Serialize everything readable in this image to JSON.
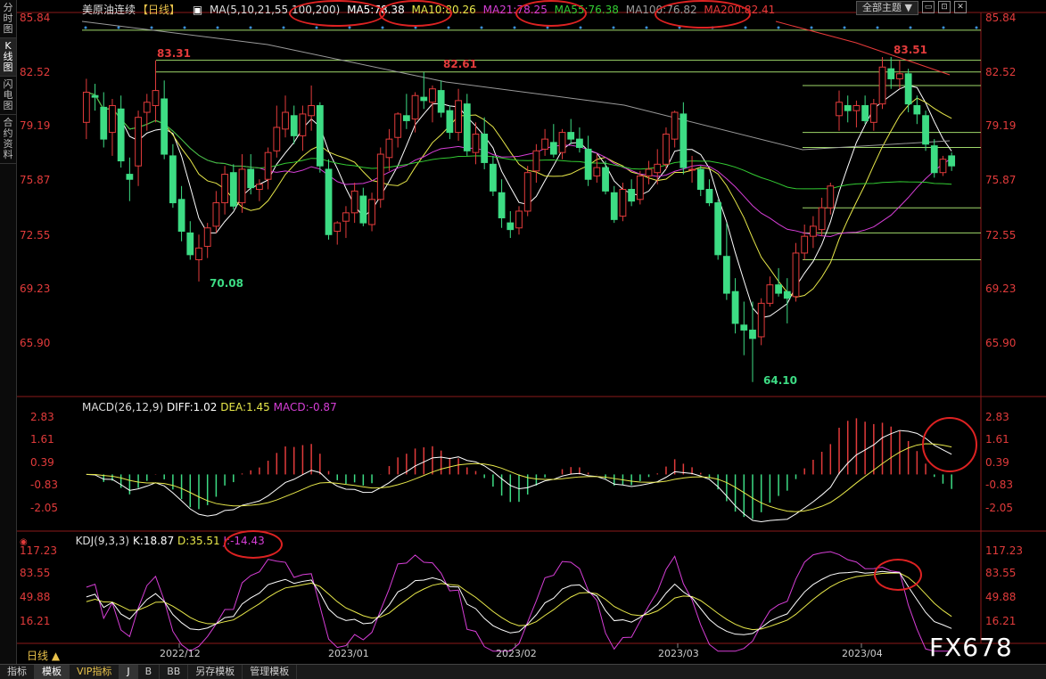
{
  "sidebar": {
    "tabs": [
      {
        "label": "分时图"
      },
      {
        "label": "K线图"
      },
      {
        "label": "闪电图"
      },
      {
        "label": "合约资料"
      }
    ]
  },
  "header": {
    "instrument": "美原油连续",
    "period_tag": "【日线】",
    "ma_params": "MA(5,10,21,55,100,200)",
    "ma5": "MA5:78.38",
    "ma10": "MA10:80.26",
    "ma21": "MA21:78.25",
    "ma55": "MA55:76.38",
    "ma100": "MA100:76.82",
    "ma200": "MA200:82.41",
    "theme_button": "全部主题",
    "theme_arrow": "▼"
  },
  "colors": {
    "up": "#e23b3b",
    "down": "#3ddc84",
    "ma5": "#ffffff",
    "ma10": "#e8e84a",
    "ma21": "#d63ed6",
    "ma55": "#33cc33",
    "ma100": "#9a9a9a",
    "ma200": "#e83a3a",
    "axis_text": "#e23b3b",
    "grid": "#8b1a1a"
  },
  "price_axis": {
    "ticks": [
      "85.84",
      "82.52",
      "79.19",
      "75.87",
      "72.55",
      "69.23",
      "65.90"
    ]
  },
  "annotations": {
    "high1": "83.31",
    "high2": "82.61",
    "high3": "83.51",
    "low1": "70.08",
    "low2": "64.10"
  },
  "macd": {
    "label": "MACD(26,12,9)",
    "diff": "DIFF:1.02",
    "dea": "DEA:1.45",
    "macd": "MACD:-0.87",
    "ticks": [
      "2.83",
      "1.61",
      "0.39",
      "-0.83",
      "-2.05"
    ]
  },
  "kdj": {
    "label": "KDJ(9,3,3)",
    "k": "K:18.87",
    "d": "D:35.51",
    "j": "J:-14.43",
    "ticks": [
      "117.23",
      "83.55",
      "49.88",
      "16.21"
    ]
  },
  "date_axis": {
    "labels": [
      "2022/12",
      "2023/01",
      "2023/02",
      "2023/03",
      "2023/04"
    ]
  },
  "period_label": "日线 ▲",
  "bottom_bar": {
    "items": [
      "指标",
      "模板",
      "VIP指标",
      "J",
      "B",
      "BB",
      "另存模板",
      "管理模板"
    ]
  },
  "watermark": "FX678",
  "chart_data": {
    "type": "candlestick",
    "title": "美原油连续 日线",
    "ylim": [
      63.5,
      85.84
    ],
    "candles": [
      {
        "o": 79.6,
        "h": 82.2,
        "l": 78.6,
        "c": 81.4
      },
      {
        "o": 81.2,
        "h": 81.9,
        "l": 80.3,
        "c": 81.1
      },
      {
        "o": 80.5,
        "h": 81.4,
        "l": 78.1,
        "c": 78.6
      },
      {
        "o": 79.0,
        "h": 81.0,
        "l": 77.6,
        "c": 80.6
      },
      {
        "o": 80.4,
        "h": 81.2,
        "l": 76.9,
        "c": 77.3
      },
      {
        "o": 76.5,
        "h": 77.5,
        "l": 74.9,
        "c": 76.2
      },
      {
        "o": 77.0,
        "h": 80.3,
        "l": 75.8,
        "c": 79.9
      },
      {
        "o": 80.2,
        "h": 81.3,
        "l": 79.1,
        "c": 80.8
      },
      {
        "o": 80.6,
        "h": 83.3,
        "l": 79.6,
        "c": 81.5
      },
      {
        "o": 81.0,
        "h": 82.1,
        "l": 77.4,
        "c": 77.7
      },
      {
        "o": 77.6,
        "h": 78.3,
        "l": 74.5,
        "c": 74.8
      },
      {
        "o": 75.0,
        "h": 75.8,
        "l": 72.5,
        "c": 73.1
      },
      {
        "o": 73.0,
        "h": 73.7,
        "l": 71.4,
        "c": 71.7
      },
      {
        "o": 71.4,
        "h": 72.9,
        "l": 70.1,
        "c": 72.1
      },
      {
        "o": 72.2,
        "h": 73.6,
        "l": 71.5,
        "c": 73.3
      },
      {
        "o": 73.4,
        "h": 75.5,
        "l": 73.0,
        "c": 74.8
      },
      {
        "o": 74.8,
        "h": 77.0,
        "l": 74.1,
        "c": 76.5
      },
      {
        "o": 76.6,
        "h": 77.1,
        "l": 74.4,
        "c": 74.6
      },
      {
        "o": 74.8,
        "h": 77.7,
        "l": 74.2,
        "c": 76.8
      },
      {
        "o": 76.8,
        "h": 77.7,
        "l": 75.3,
        "c": 75.7
      },
      {
        "o": 75.6,
        "h": 76.2,
        "l": 74.9,
        "c": 75.9
      },
      {
        "o": 76.2,
        "h": 78.1,
        "l": 75.6,
        "c": 77.8
      },
      {
        "o": 77.9,
        "h": 80.6,
        "l": 77.5,
        "c": 79.3
      },
      {
        "o": 79.2,
        "h": 81.2,
        "l": 78.7,
        "c": 80.2
      },
      {
        "o": 80.0,
        "h": 80.6,
        "l": 78.3,
        "c": 78.8
      },
      {
        "o": 78.8,
        "h": 80.6,
        "l": 77.9,
        "c": 80.1
      },
      {
        "o": 80.0,
        "h": 81.8,
        "l": 79.1,
        "c": 80.6
      },
      {
        "o": 80.6,
        "h": 80.8,
        "l": 76.6,
        "c": 77.0
      },
      {
        "o": 76.8,
        "h": 77.4,
        "l": 72.6,
        "c": 72.9
      },
      {
        "o": 73.1,
        "h": 73.7,
        "l": 72.3,
        "c": 73.6
      },
      {
        "o": 73.7,
        "h": 74.6,
        "l": 72.7,
        "c": 74.2
      },
      {
        "o": 74.2,
        "h": 76.0,
        "l": 73.6,
        "c": 75.5
      },
      {
        "o": 75.2,
        "h": 75.7,
        "l": 73.4,
        "c": 73.6
      },
      {
        "o": 73.5,
        "h": 75.4,
        "l": 73.1,
        "c": 75.0
      },
      {
        "o": 75.0,
        "h": 78.1,
        "l": 74.5,
        "c": 77.7
      },
      {
        "o": 77.5,
        "h": 79.2,
        "l": 76.7,
        "c": 78.6
      },
      {
        "o": 78.7,
        "h": 80.2,
        "l": 78.1,
        "c": 80.1
      },
      {
        "o": 80.0,
        "h": 81.3,
        "l": 79.2,
        "c": 79.7
      },
      {
        "o": 79.8,
        "h": 81.4,
        "l": 79.0,
        "c": 81.2
      },
      {
        "o": 81.1,
        "h": 82.6,
        "l": 80.4,
        "c": 80.9
      },
      {
        "o": 80.8,
        "h": 81.8,
        "l": 79.6,
        "c": 81.6
      },
      {
        "o": 81.5,
        "h": 82.1,
        "l": 79.9,
        "c": 80.2
      },
      {
        "o": 80.3,
        "h": 80.6,
        "l": 78.6,
        "c": 79.0
      },
      {
        "o": 79.0,
        "h": 81.6,
        "l": 78.5,
        "c": 80.9
      },
      {
        "o": 80.7,
        "h": 81.3,
        "l": 77.6,
        "c": 77.9
      },
      {
        "o": 77.8,
        "h": 79.6,
        "l": 77.1,
        "c": 78.9
      },
      {
        "o": 78.9,
        "h": 79.9,
        "l": 76.8,
        "c": 77.2
      },
      {
        "o": 77.1,
        "h": 77.6,
        "l": 75.2,
        "c": 75.5
      },
      {
        "o": 75.4,
        "h": 76.2,
        "l": 73.3,
        "c": 73.9
      },
      {
        "o": 73.6,
        "h": 74.3,
        "l": 72.7,
        "c": 73.2
      },
      {
        "o": 73.3,
        "h": 74.6,
        "l": 72.9,
        "c": 74.3
      },
      {
        "o": 74.3,
        "h": 77.0,
        "l": 74.0,
        "c": 76.6
      },
      {
        "o": 76.7,
        "h": 78.3,
        "l": 76.0,
        "c": 77.9
      },
      {
        "o": 78.0,
        "h": 79.2,
        "l": 77.6,
        "c": 78.6
      },
      {
        "o": 78.4,
        "h": 79.5,
        "l": 77.5,
        "c": 77.7
      },
      {
        "o": 77.8,
        "h": 79.2,
        "l": 77.4,
        "c": 79.0
      },
      {
        "o": 79.0,
        "h": 79.8,
        "l": 78.3,
        "c": 78.6
      },
      {
        "o": 78.6,
        "h": 79.3,
        "l": 77.8,
        "c": 78.1
      },
      {
        "o": 78.0,
        "h": 78.8,
        "l": 75.8,
        "c": 76.2
      },
      {
        "o": 76.4,
        "h": 77.7,
        "l": 76.0,
        "c": 76.9
      },
      {
        "o": 76.9,
        "h": 77.3,
        "l": 75.3,
        "c": 75.5
      },
      {
        "o": 75.4,
        "h": 75.8,
        "l": 73.6,
        "c": 73.8
      },
      {
        "o": 74.0,
        "h": 76.0,
        "l": 73.7,
        "c": 75.6
      },
      {
        "o": 75.6,
        "h": 76.2,
        "l": 74.6,
        "c": 74.9
      },
      {
        "o": 75.0,
        "h": 76.7,
        "l": 74.7,
        "c": 76.4
      },
      {
        "o": 76.4,
        "h": 77.3,
        "l": 75.9,
        "c": 76.8
      },
      {
        "o": 76.6,
        "h": 78.0,
        "l": 75.9,
        "c": 77.1
      },
      {
        "o": 77.1,
        "h": 79.3,
        "l": 76.8,
        "c": 78.9
      },
      {
        "o": 78.6,
        "h": 80.3,
        "l": 78.1,
        "c": 80.2
      },
      {
        "o": 80.1,
        "h": 80.8,
        "l": 76.5,
        "c": 76.9
      },
      {
        "o": 76.8,
        "h": 77.6,
        "l": 76.0,
        "c": 76.8
      },
      {
        "o": 76.8,
        "h": 77.0,
        "l": 75.2,
        "c": 75.6
      },
      {
        "o": 75.6,
        "h": 76.2,
        "l": 74.6,
        "c": 74.8
      },
      {
        "o": 74.8,
        "h": 75.0,
        "l": 71.4,
        "c": 71.7
      },
      {
        "o": 71.6,
        "h": 73.6,
        "l": 69.0,
        "c": 69.4
      },
      {
        "o": 69.5,
        "h": 70.3,
        "l": 67.0,
        "c": 67.6
      },
      {
        "o": 67.5,
        "h": 68.9,
        "l": 65.7,
        "c": 67.2
      },
      {
        "o": 67.2,
        "h": 68.9,
        "l": 64.1,
        "c": 66.7
      },
      {
        "o": 66.8,
        "h": 69.1,
        "l": 66.3,
        "c": 68.8
      },
      {
        "o": 68.8,
        "h": 70.4,
        "l": 68.6,
        "c": 69.9
      },
      {
        "o": 69.9,
        "h": 70.9,
        "l": 69.2,
        "c": 69.4
      },
      {
        "o": 69.5,
        "h": 70.3,
        "l": 67.6,
        "c": 69.1
      },
      {
        "o": 69.2,
        "h": 72.4,
        "l": 68.9,
        "c": 71.8
      },
      {
        "o": 71.8,
        "h": 73.5,
        "l": 71.4,
        "c": 72.8
      },
      {
        "o": 72.8,
        "h": 74.0,
        "l": 72.1,
        "c": 73.4
      },
      {
        "o": 73.2,
        "h": 75.1,
        "l": 72.8,
        "c": 74.5
      },
      {
        "o": 74.5,
        "h": 76.0,
        "l": 74.1,
        "c": 75.8
      },
      {
        "o": 80.0,
        "h": 81.5,
        "l": 79.1,
        "c": 80.8
      },
      {
        "o": 80.6,
        "h": 81.2,
        "l": 79.6,
        "c": 80.3
      },
      {
        "o": 80.3,
        "h": 80.9,
        "l": 79.3,
        "c": 80.6
      },
      {
        "o": 80.6,
        "h": 81.2,
        "l": 79.5,
        "c": 79.7
      },
      {
        "o": 79.6,
        "h": 81.0,
        "l": 79.1,
        "c": 80.7
      },
      {
        "o": 80.7,
        "h": 83.5,
        "l": 80.4,
        "c": 82.9
      },
      {
        "o": 82.8,
        "h": 83.5,
        "l": 81.6,
        "c": 82.2
      },
      {
        "o": 82.2,
        "h": 83.3,
        "l": 81.6,
        "c": 82.5
      },
      {
        "o": 82.5,
        "h": 82.8,
        "l": 80.2,
        "c": 80.7
      },
      {
        "o": 80.6,
        "h": 81.2,
        "l": 79.5,
        "c": 80.1
      },
      {
        "o": 80.0,
        "h": 80.3,
        "l": 77.9,
        "c": 78.3
      },
      {
        "o": 78.2,
        "h": 78.6,
        "l": 76.3,
        "c": 76.6
      },
      {
        "o": 76.6,
        "h": 77.6,
        "l": 76.4,
        "c": 77.4
      },
      {
        "o": 77.6,
        "h": 77.8,
        "l": 76.7,
        "c": 77.0
      }
    ],
    "macd_ylim": [
      -2.6,
      3.0
    ],
    "kdj_ylim": [
      0,
      125
    ],
    "horizontal_levels": [
      85.1,
      83.31,
      82.61,
      81.8,
      79.0,
      78.1,
      74.5,
      73.0,
      71.4
    ]
  }
}
